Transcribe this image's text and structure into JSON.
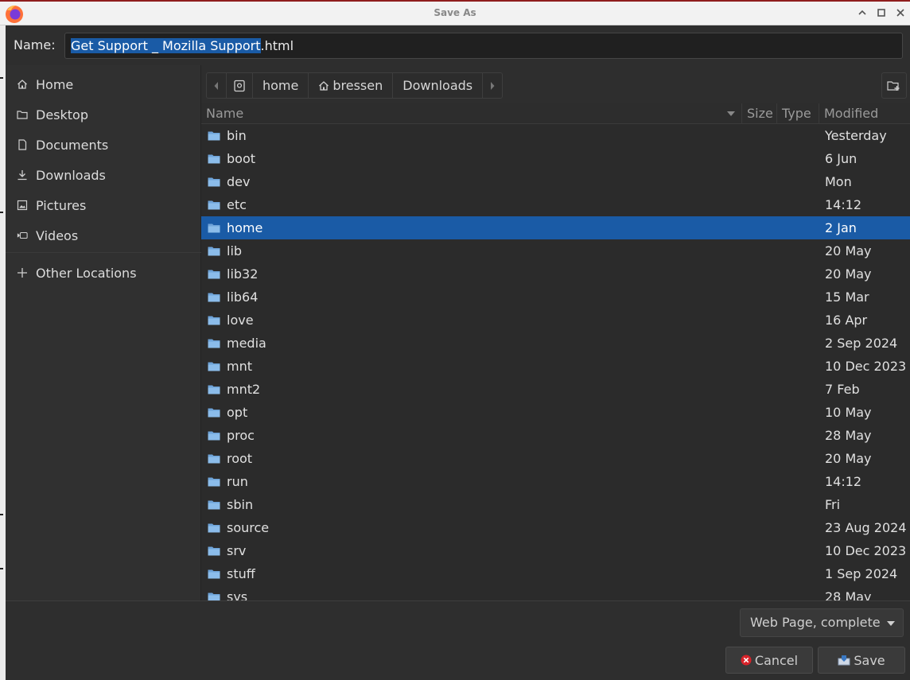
{
  "window": {
    "title": "Save As"
  },
  "name_row": {
    "label": "Name:",
    "filename_selected": "Get Support _ Mozilla Support",
    "filename_extension": ".html"
  },
  "sidebar": {
    "items": [
      {
        "label": "Home",
        "icon": "home-icon"
      },
      {
        "label": "Desktop",
        "icon": "folder-icon"
      },
      {
        "label": "Documents",
        "icon": "document-icon"
      },
      {
        "label": "Downloads",
        "icon": "download-icon"
      },
      {
        "label": "Pictures",
        "icon": "picture-icon"
      },
      {
        "label": "Videos",
        "icon": "video-icon"
      }
    ],
    "other_locations": "Other Locations"
  },
  "pathbar": {
    "segments": [
      "home",
      "bressen",
      "Downloads"
    ]
  },
  "list": {
    "columns": {
      "name": "Name",
      "size": "Size",
      "type": "Type",
      "modified": "Modified"
    },
    "rows": [
      {
        "name": "bin",
        "modified": "Yesterday"
      },
      {
        "name": "boot",
        "modified": "6 Jun"
      },
      {
        "name": "dev",
        "modified": "Mon"
      },
      {
        "name": "etc",
        "modified": "14:12"
      },
      {
        "name": "home",
        "modified": "2 Jan",
        "selected": true
      },
      {
        "name": "lib",
        "modified": "20 May"
      },
      {
        "name": "lib32",
        "modified": "20 May"
      },
      {
        "name": "lib64",
        "modified": "15 Mar"
      },
      {
        "name": "love",
        "modified": "16 Apr"
      },
      {
        "name": "media",
        "modified": "2 Sep 2024"
      },
      {
        "name": "mnt",
        "modified": "10 Dec 2023"
      },
      {
        "name": "mnt2",
        "modified": "7 Feb"
      },
      {
        "name": "opt",
        "modified": "10 May"
      },
      {
        "name": "proc",
        "modified": "28 May"
      },
      {
        "name": "root",
        "modified": "20 May"
      },
      {
        "name": "run",
        "modified": "14:12"
      },
      {
        "name": "sbin",
        "modified": "Fri"
      },
      {
        "name": "source",
        "modified": "23 Aug 2024"
      },
      {
        "name": "srv",
        "modified": "10 Dec 2023"
      },
      {
        "name": "stuff",
        "modified": "1 Sep 2024"
      },
      {
        "name": "sys",
        "modified": "28 May"
      }
    ]
  },
  "footer": {
    "filetype_selected": "Web Page, complete",
    "cancel_label": "Cancel",
    "save_label": "Save"
  },
  "colors": {
    "accent": "#1a5ba6",
    "folder": "#6ea3d8",
    "background": "#2b2b2b"
  }
}
